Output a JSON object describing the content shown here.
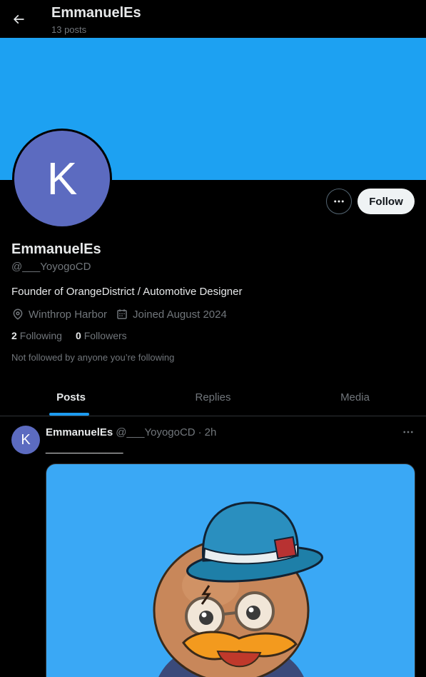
{
  "header": {
    "title": "EmmanuelEs",
    "subtitle": "13 posts",
    "back_icon": "arrow-left-icon"
  },
  "colors": {
    "banner": "#1da1f2",
    "avatar": "#5c6bc0",
    "accent": "#1d9bf0",
    "media_bg": "#3aa8f5"
  },
  "profile": {
    "avatar_letter": "K",
    "name": "EmmanuelEs",
    "handle": "@___YoyogoCD",
    "bio": "Founder of OrangeDistrict / Automotive Designer",
    "location": "Winthrop Harbor",
    "joined": "Joined August 2024",
    "following_count": "2",
    "following_label": "Following",
    "followers_count": "0",
    "followers_label": "Followers",
    "not_followed_text": "Not followed by anyone you’re following",
    "follow_button": "Follow"
  },
  "tabs": [
    {
      "label": "Posts",
      "active": true
    },
    {
      "label": "Replies",
      "active": false
    },
    {
      "label": "Media",
      "active": false
    }
  ],
  "post": {
    "avatar_letter": "K",
    "name": "EmmanuelEs",
    "handle": "@___YoyogoCD",
    "separator": "·",
    "time": "2h",
    "text": "_____________",
    "media_description_icon": "duck-character-icon"
  }
}
